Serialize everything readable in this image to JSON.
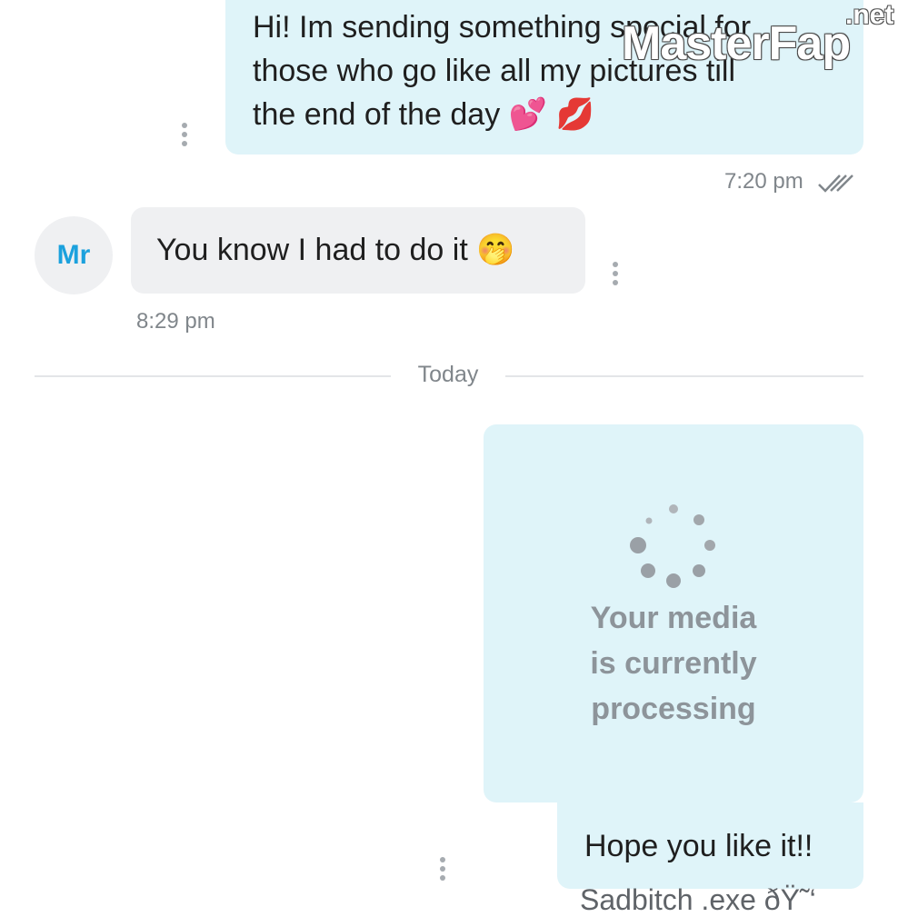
{
  "messages": {
    "msg1": {
      "line1": "Hi! Im sending something special for",
      "line2": "those who go like all my pictures till",
      "line3": "the end of the day",
      "emoji": "💕 💋",
      "time": "7:20 pm",
      "read_icon": "double-check-icon"
    },
    "msg2": {
      "avatar": "Mr",
      "text": "You know I had to do it 🤭",
      "time": "8:29 pm"
    },
    "divider": {
      "label": "Today"
    },
    "media": {
      "line1": "Your media",
      "line2": "is currently",
      "line3": "processing",
      "icon": "loading-spinner-icon"
    },
    "msg3": {
      "text": "Hope you like it!!"
    },
    "footer_caption": "Sadbitch .exe ðŸ˜‘"
  },
  "watermark": {
    "main": "MasterFap",
    "suffix": ".net"
  },
  "colors": {
    "outgoing_bubble": "#dff4f9",
    "incoming_bubble": "#eff0f2",
    "avatar_text": "#1ba1dd",
    "meta_text": "#80868b",
    "watermark_pink": "#e01ba0"
  }
}
